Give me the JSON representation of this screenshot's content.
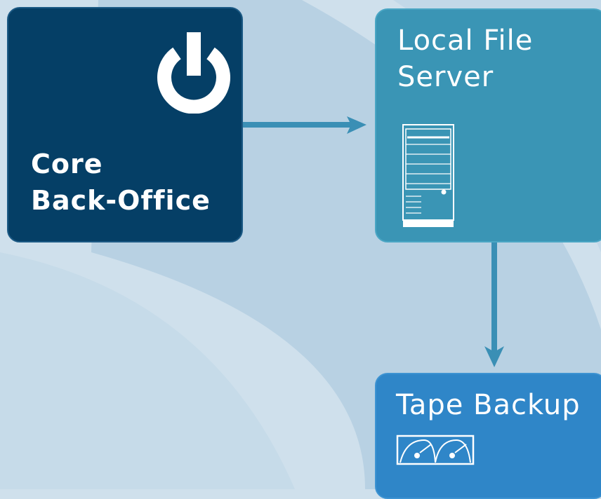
{
  "nodes": {
    "core": {
      "label_line1": "Core",
      "label_line2": "Back-Office",
      "icon": "power-icon",
      "color": "#053f66"
    },
    "file_server": {
      "label_line1": "Local File",
      "label_line2": "Server",
      "icon": "server-tower-icon",
      "color": "#3a95b5"
    },
    "tape_backup": {
      "label": "Tape Backup",
      "icon": "tape-cassette-icon",
      "color": "#2f86c8"
    }
  },
  "edges": [
    {
      "from": "Core Back-Office",
      "to": "Local File Server"
    },
    {
      "from": "Local File Server",
      "to": "Tape Backup"
    }
  ],
  "arrow_color": "#3a8fb5"
}
